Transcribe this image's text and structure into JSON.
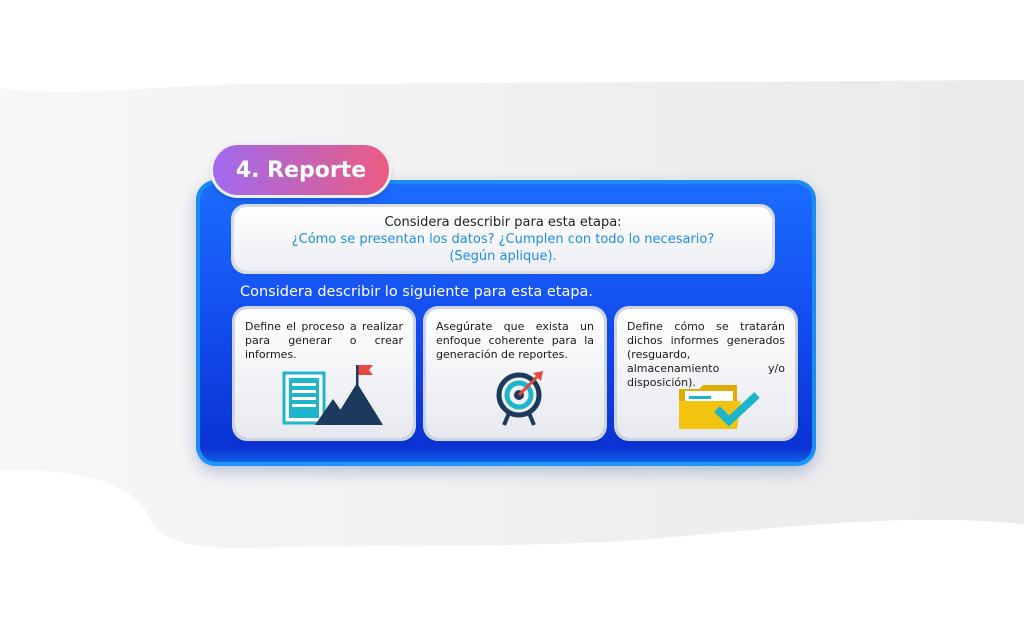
{
  "title": "4. Reporte",
  "question": {
    "line1": "Considera describir para esta etapa:",
    "line2": "¿Cómo se presentan los datos? ¿Cumplen con todo lo necesario?",
    "line3": "(Según aplique)."
  },
  "subtitle": "Considera describir lo siguiente para esta etapa.",
  "cards": [
    {
      "text": "Define el proceso a realizar para generar o crear informes.",
      "icon": "document-mountain-flag-icon"
    },
    {
      "text": "Asegúrate que exista un enfoque coherente para la generación de reportes.",
      "icon": "target-arrow-icon"
    },
    {
      "text": "Define cómo se tratarán dichos informes generados (resguardo, almacenamiento y/o disposición).",
      "icon": "folder-check-icon"
    }
  ],
  "colors": {
    "panel": "#1450f0",
    "pill_start": "#a06af0",
    "pill_end": "#ec5c82",
    "accent_blue": "#1f8de8",
    "teal": "#1fb5c8",
    "navy": "#1b3a5c",
    "red": "#e8473f",
    "yellow": "#f2c40f"
  }
}
